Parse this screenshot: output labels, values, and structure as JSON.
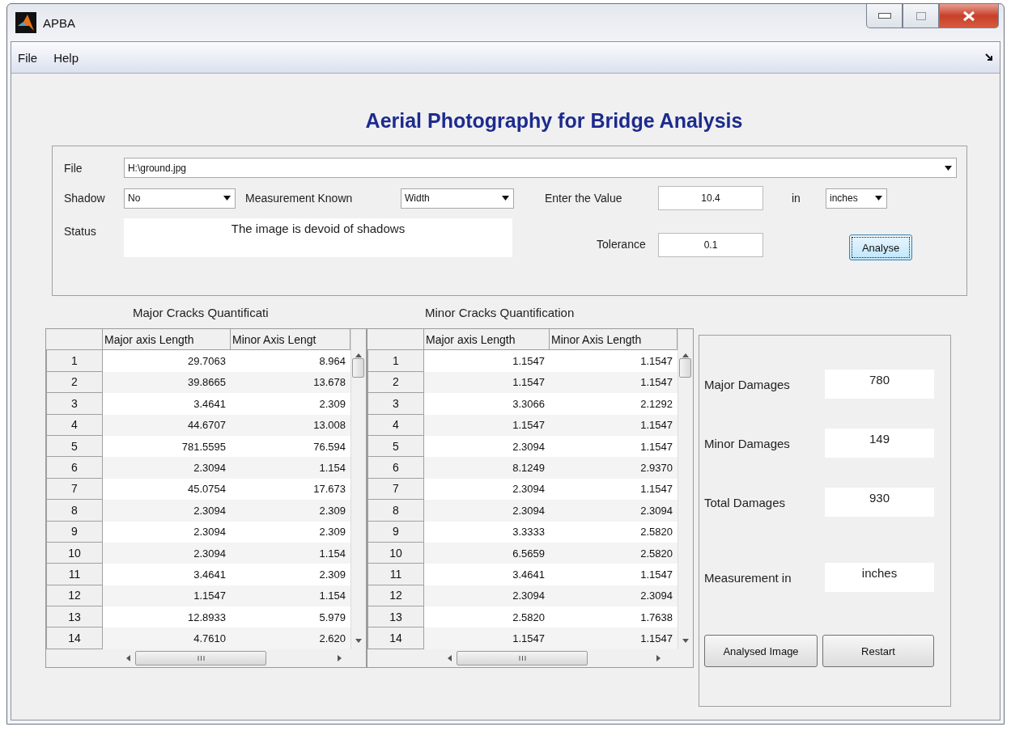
{
  "window": {
    "title": "APBA"
  },
  "menu": [
    "File",
    "Help"
  ],
  "heading": "Aerial Photography for Bridge Analysis",
  "form": {
    "file": {
      "label": "File",
      "value": "H:\\ground.jpg"
    },
    "shadow": {
      "label": "Shadow",
      "value": "No"
    },
    "measurement_known": {
      "label": "Measurement Known",
      "value": "Width"
    },
    "entered_value": {
      "label": "Enter the Value",
      "value": "10.4"
    },
    "unit": {
      "label": "in",
      "value": "inches"
    },
    "status": {
      "label": "Status",
      "value": "The image is devoid of shadows"
    },
    "tolerance": {
      "label": "Tolerance",
      "value": "0.1"
    },
    "analyse_button": "Analyse"
  },
  "major_table": {
    "title": "Major Cracks Quantificati",
    "columns": [
      "Major axis Length",
      "Minor Axis Lengt"
    ],
    "rows": [
      [
        "1",
        "29.7063",
        "8.964"
      ],
      [
        "2",
        "39.8665",
        "13.678"
      ],
      [
        "3",
        "3.4641",
        "2.309"
      ],
      [
        "4",
        "44.6707",
        "13.008"
      ],
      [
        "5",
        "781.5595",
        "76.594"
      ],
      [
        "6",
        "2.3094",
        "1.154"
      ],
      [
        "7",
        "45.0754",
        "17.673"
      ],
      [
        "8",
        "2.3094",
        "2.309"
      ],
      [
        "9",
        "2.3094",
        "2.309"
      ],
      [
        "10",
        "2.3094",
        "1.154"
      ],
      [
        "11",
        "3.4641",
        "2.309"
      ],
      [
        "12",
        "1.1547",
        "1.154"
      ],
      [
        "13",
        "12.8933",
        "5.979"
      ],
      [
        "14",
        "4.7610",
        "2.620"
      ]
    ]
  },
  "minor_table": {
    "title": "Minor Cracks Quantification",
    "columns": [
      "Major axis Length",
      "Minor Axis Length"
    ],
    "rows": [
      [
        "1",
        "1.1547",
        "1.1547"
      ],
      [
        "2",
        "1.1547",
        "1.1547"
      ],
      [
        "3",
        "3.3066",
        "2.1292"
      ],
      [
        "4",
        "1.1547",
        "1.1547"
      ],
      [
        "5",
        "2.3094",
        "1.1547"
      ],
      [
        "6",
        "8.1249",
        "2.9370"
      ],
      [
        "7",
        "2.3094",
        "1.1547"
      ],
      [
        "8",
        "2.3094",
        "2.3094"
      ],
      [
        "9",
        "3.3333",
        "2.5820"
      ],
      [
        "10",
        "6.5659",
        "2.5820"
      ],
      [
        "11",
        "3.4641",
        "1.1547"
      ],
      [
        "12",
        "2.3094",
        "2.3094"
      ],
      [
        "13",
        "2.5820",
        "1.7638"
      ],
      [
        "14",
        "1.1547",
        "1.1547"
      ]
    ]
  },
  "summary": {
    "items": [
      {
        "label": "Major Damages",
        "value": "780"
      },
      {
        "label": "Minor Damages",
        "value": "149"
      },
      {
        "label": "Total Damages",
        "value": "930"
      },
      {
        "label": "Measurement in",
        "value": "inches"
      }
    ],
    "buttons": [
      "Analysed Image",
      "Restart"
    ]
  }
}
